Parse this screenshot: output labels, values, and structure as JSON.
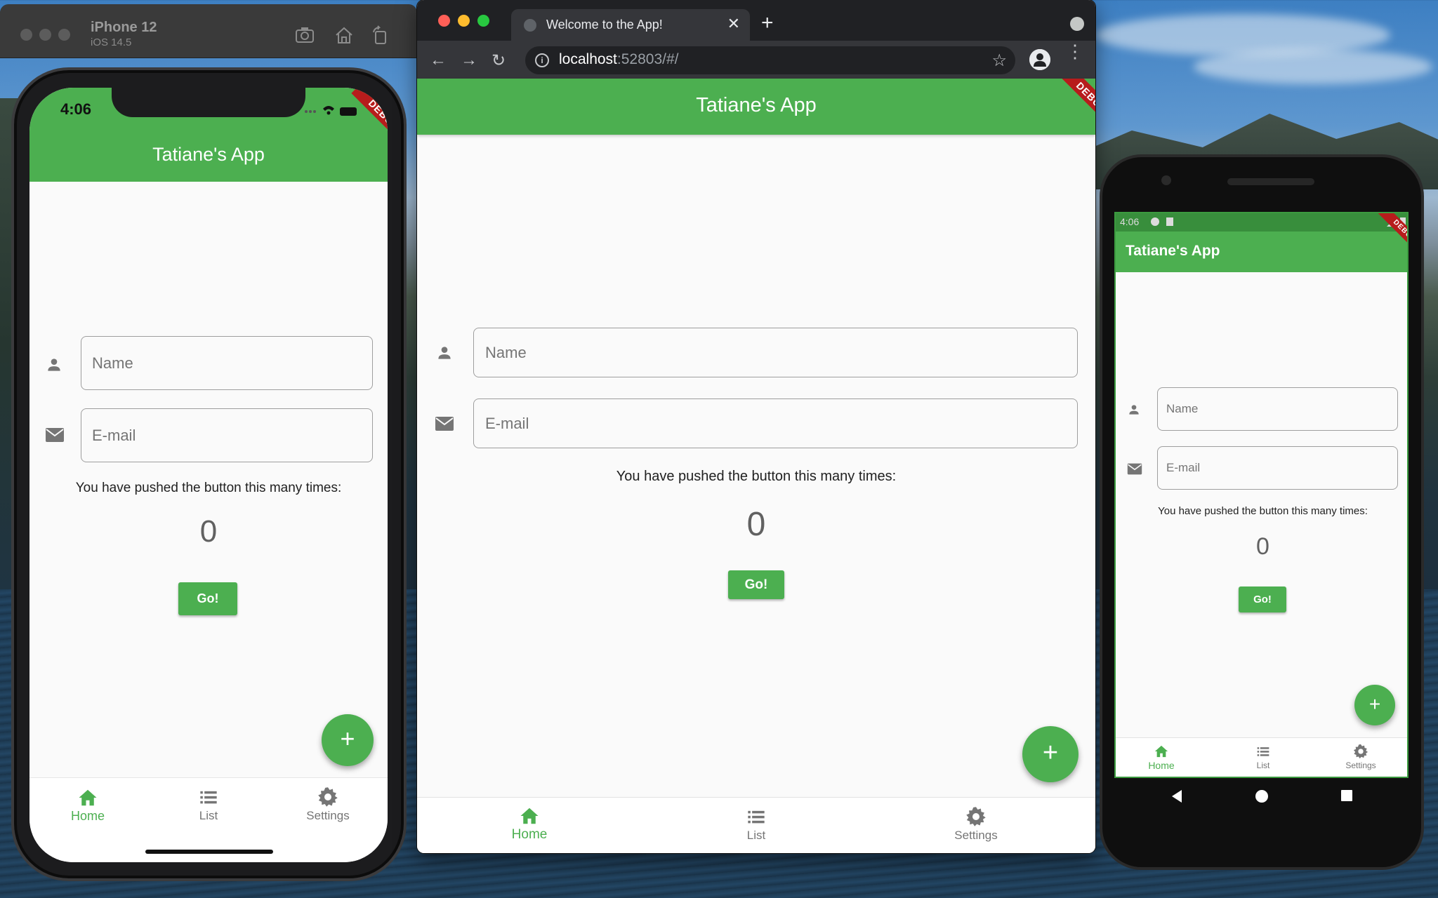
{
  "simulator": {
    "device_name": "iPhone 12",
    "os_version": "iOS 14.5"
  },
  "iphone": {
    "status_time": "4:06",
    "app_title": "Tatiane's App",
    "debug_label": "DEBUG",
    "name_placeholder": "Name",
    "email_placeholder": "E-mail",
    "counter_label": "You have pushed the button this many times:",
    "counter_value": "0",
    "go_label": "Go!",
    "fab_label": "+",
    "nav": [
      {
        "label": "Home",
        "icon": "home-icon",
        "active": true
      },
      {
        "label": "List",
        "icon": "list-icon",
        "active": false
      },
      {
        "label": "Settings",
        "icon": "gear-icon",
        "active": false
      }
    ]
  },
  "browser": {
    "tab_title": "Welcome to the App!",
    "url_host": "localhost",
    "url_rest": ":52803/#/",
    "app_title": "Tatiane's App",
    "debug_label": "DEBUG",
    "name_placeholder": "Name",
    "email_placeholder": "E-mail",
    "counter_label": "You have pushed the button this many times:",
    "counter_value": "0",
    "go_label": "Go!",
    "fab_label": "+",
    "nav": [
      {
        "label": "Home",
        "icon": "home-icon",
        "active": true
      },
      {
        "label": "List",
        "icon": "list-icon",
        "active": false
      },
      {
        "label": "Settings",
        "icon": "gear-icon",
        "active": false
      }
    ]
  },
  "android": {
    "status_time": "4:06",
    "app_title": "Tatiane's App",
    "debug_label": "DEBUG",
    "name_placeholder": "Name",
    "email_placeholder": "E-mail",
    "counter_label": "You have pushed the button this many times:",
    "counter_value": "0",
    "go_label": "Go!",
    "fab_label": "+",
    "nav": [
      {
        "label": "Home",
        "icon": "home-icon",
        "active": true
      },
      {
        "label": "List",
        "icon": "list-icon",
        "active": false
      },
      {
        "label": "Settings",
        "icon": "gear-icon",
        "active": false
      }
    ]
  },
  "colors": {
    "primary": "#4caf50",
    "primary_dark": "#388e3c",
    "debug_ribbon": "#b71c1c",
    "inactive_nav": "#757575",
    "chrome_dark": "#202124"
  }
}
